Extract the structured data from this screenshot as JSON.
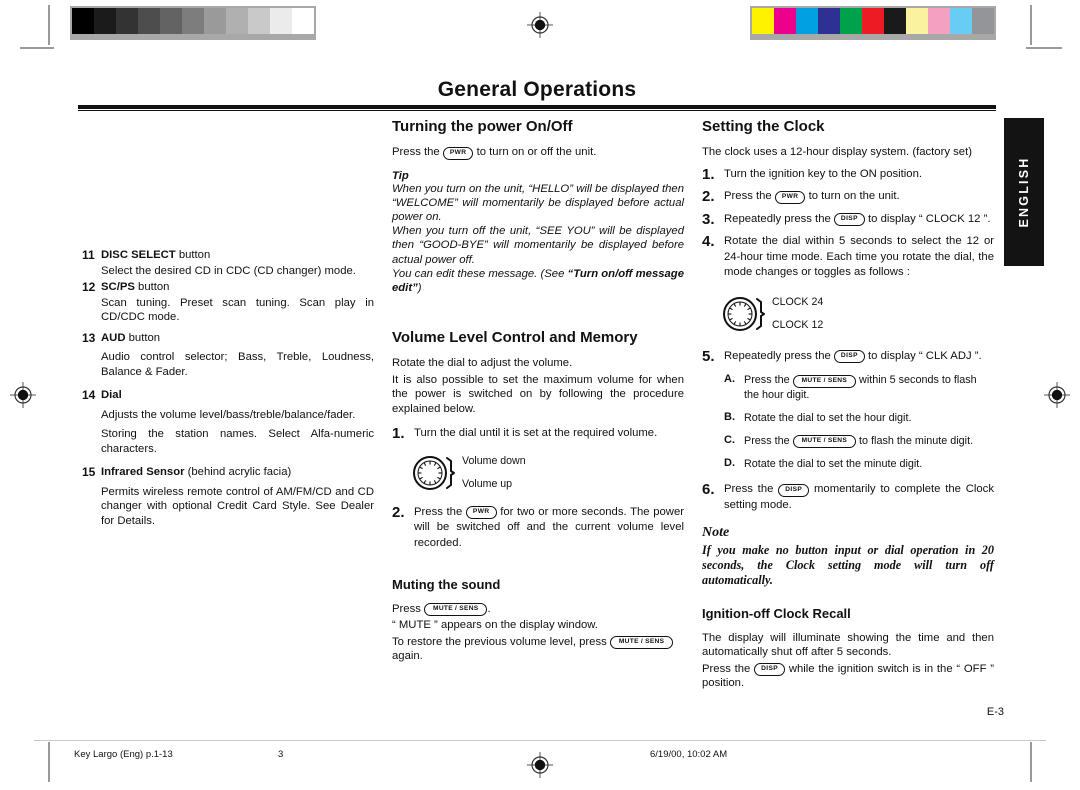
{
  "calibration": {
    "gray_swatches": [
      "#000000",
      "#1b1b1b",
      "#333333",
      "#4d4d4d",
      "#636363",
      "#7d7d7d",
      "#9a9a9a",
      "#b0b0b0",
      "#c9c9c9",
      "#ebebeb",
      "#ffffff"
    ],
    "color_swatches": [
      "#fff200",
      "#ec008c",
      "#00a0e3",
      "#2e3192",
      "#00a14b",
      "#ed1c24",
      "#1a1a1a",
      "#fbf2a0",
      "#f4a0c0",
      "#67cdf4",
      "#939598"
    ]
  },
  "header": {
    "title": "General Operations",
    "language_tab": "ENGLISH"
  },
  "left_column": {
    "items": [
      {
        "number": "11",
        "name": "DISC SELECT",
        "suffix": " button",
        "desc": [
          "Select the desired CD in CDC (CD changer) mode."
        ]
      },
      {
        "number": "12",
        "name": "SC/PS",
        "suffix": " button",
        "desc": [
          "Scan tuning. Preset scan tuning. Scan play in CD/CDC mode."
        ]
      },
      {
        "number": "13",
        "name": "AUD",
        "suffix": " button",
        "desc": [
          "Audio control selector; Bass, Treble, Loudness, Balance & Fader."
        ]
      },
      {
        "number": "14",
        "name": "Dial",
        "suffix": "",
        "desc": [
          "Adjusts the volume level/bass/treble/balance/fader.",
          "Storing the station names. Select Alfa-numeric characters."
        ]
      },
      {
        "number": "15",
        "name": "Infrared Sensor",
        "suffix": " (behind acrylic facia)",
        "desc": [
          "Permits wireless remote control of AM/FM/CD and CD changer with optional Credit Card Style. See Dealer for Details."
        ]
      }
    ]
  },
  "middle_column": {
    "power": {
      "heading": "Turning the power On/Off",
      "intro_before": "Press the",
      "key_pwr": "PWR",
      "intro_after": "to turn on or off the unit.",
      "tip_heading": "Tip",
      "tip_lines": [
        "When you turn on the unit, “HELLO” will be displayed then “WELCOME” will momentarily be displayed before actual power on.",
        "When you turn off the unit, “SEE YOU” will be displayed then “GOOD-BYE” will momentarily be displayed before actual power off."
      ],
      "tip_edit_before": "You can edit these message. (See ",
      "tip_edit_bold": "“Turn on/off message edit”",
      "tip_edit_after": ")"
    },
    "volume": {
      "heading": "Volume Level Control and Memory",
      "intro_lines": [
        "Rotate the dial to adjust the volume.",
        "It is also possible to set the maximum volume for when the power is switched on by following the procedure explained below."
      ],
      "step1_num": "1.",
      "step1_text": "Turn the dial until it is set at the required volume.",
      "dial_label_top": "Volume down",
      "dial_label_bottom": "Volume up",
      "step2_num": "2.",
      "step2_before": "Press the",
      "step2_key": "PWR",
      "step2_after": "for two or more seconds. The power will be switched off and the current volume level recorded."
    },
    "muting": {
      "heading": "Muting the sound",
      "line1_before": "Press",
      "line1_key": "MUTE / SENS",
      "line1_after": ".",
      "line2": "“ MUTE ” appears on the display window.",
      "line3_before": "To restore the previous volume level, press",
      "line3_key": "MUTE / SENS",
      "line3_after": "again."
    }
  },
  "right_column": {
    "clock": {
      "heading": "Setting the Clock",
      "intro": "The clock uses a 12-hour display system. (factory set)",
      "steps": [
        {
          "num": "1.",
          "before": "Turn the ignition key to the ON position.",
          "key": "",
          "after": ""
        },
        {
          "num": "2.",
          "before": "Press the",
          "key": "PWR",
          "after": "to turn on the unit."
        },
        {
          "num": "3.",
          "before": "Repeatedly press the",
          "key": "DISP",
          "after": "to display “ CLOCK 12 ”."
        },
        {
          "num": "4.",
          "before": "Rotate the dial within 5 seconds to select the 12 or 24-hour time mode. Each time you rotate the dial, the mode changes or toggles as follows :",
          "key": "",
          "after": ""
        }
      ],
      "toggle_top": "CLOCK 24",
      "toggle_bottom": "CLOCK 12",
      "step5_num": "5.",
      "step5_before": "Repeatedly press the",
      "step5_key": "DISP",
      "step5_after": "to display “ CLK ADJ ”.",
      "substeps": [
        {
          "label": "A.",
          "before": "Press the",
          "key": "MUTE / SENS",
          "after": "within 5 seconds to flash the hour digit."
        },
        {
          "label": "B.",
          "before": "Rotate the dial to set the hour digit.",
          "key": "",
          "after": ""
        },
        {
          "label": "C.",
          "before": "Press  the",
          "key": "MUTE / SENS",
          "after": "to flash the minute digit."
        },
        {
          "label": "D.",
          "before": "Rotate the dial to set the minute digit.",
          "key": "",
          "after": ""
        }
      ],
      "step6_num": "6.",
      "step6_before": "Press the",
      "step6_key": "DISP",
      "step6_after": "momentarily to complete the Clock setting mode.",
      "note_heading": "Note",
      "note_text": "If you make no button input or dial operation in 20 seconds, the Clock setting mode will turn off automatically."
    },
    "ignition": {
      "heading": "Ignition-off Clock Recall",
      "line1": "The display will illuminate showing the time and then automatically shut off after 5 seconds.",
      "line2_before": "Press the",
      "line2_key": "DISP",
      "line2_after": "while the ignition switch is in the “ OFF ” position."
    }
  },
  "footer": {
    "page_code": "E-3",
    "file_name": "Key Largo (Eng) p.1-13",
    "page_number": "3",
    "timestamp": "6/19/00, 10:02 AM"
  }
}
